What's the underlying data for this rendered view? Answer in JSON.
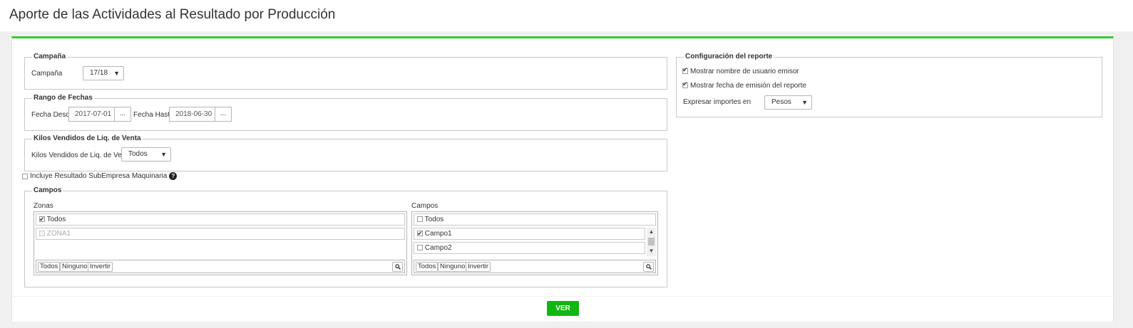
{
  "page": {
    "title": "Aporte de las Actividades al Resultado por Producción"
  },
  "colors": {
    "accent": "#33cc33",
    "primary_button": "#11b711"
  },
  "campana": {
    "legend": "Campaña",
    "label": "Campaña",
    "selected": "17/18"
  },
  "rango": {
    "legend": "Rango de Fechas",
    "desde_label": "Fecha Desde",
    "desde_value": "2017-07-01",
    "hasta_label": "Fecha Hasta",
    "hasta_value": "2018-06-30",
    "picker_label": "..."
  },
  "kilos": {
    "legend": "Kilos Vendidos de Liq. de Venta",
    "label": "Kilos Vendidos de Liq. de Venta",
    "selected": "Todos"
  },
  "subempresa": {
    "label": "Incluye Resultado SubEmpresa Maquinaria",
    "checked": false,
    "help_icon": "question-circle-icon"
  },
  "campos": {
    "legend": "Campos",
    "zonas": {
      "title": "Zonas",
      "todos_label": "Todos",
      "todos_checked": true,
      "items": [
        {
          "label": "ZONA1",
          "checked": false,
          "disabled": true
        }
      ]
    },
    "campos_list": {
      "title": "Campos",
      "todos_label": "Todos",
      "todos_checked": false,
      "items": [
        {
          "label": "Campo1",
          "checked": true
        },
        {
          "label": "Campo2",
          "checked": false
        }
      ]
    },
    "footer": {
      "todos": "Todos",
      "ninguno": "Ninguno",
      "invertir": "Invertir"
    }
  },
  "config": {
    "legend": "Configuración del reporte",
    "mostrar_usuario": "Mostrar nombre de usuario emisor",
    "mostrar_usuario_checked": true,
    "mostrar_fecha": "Mostrar fecha de emisión del reporte",
    "mostrar_fecha_checked": true,
    "expresar_label": "Expresar importes en",
    "expresar_selected": "Pesos"
  },
  "actions": {
    "ver": "VER"
  }
}
